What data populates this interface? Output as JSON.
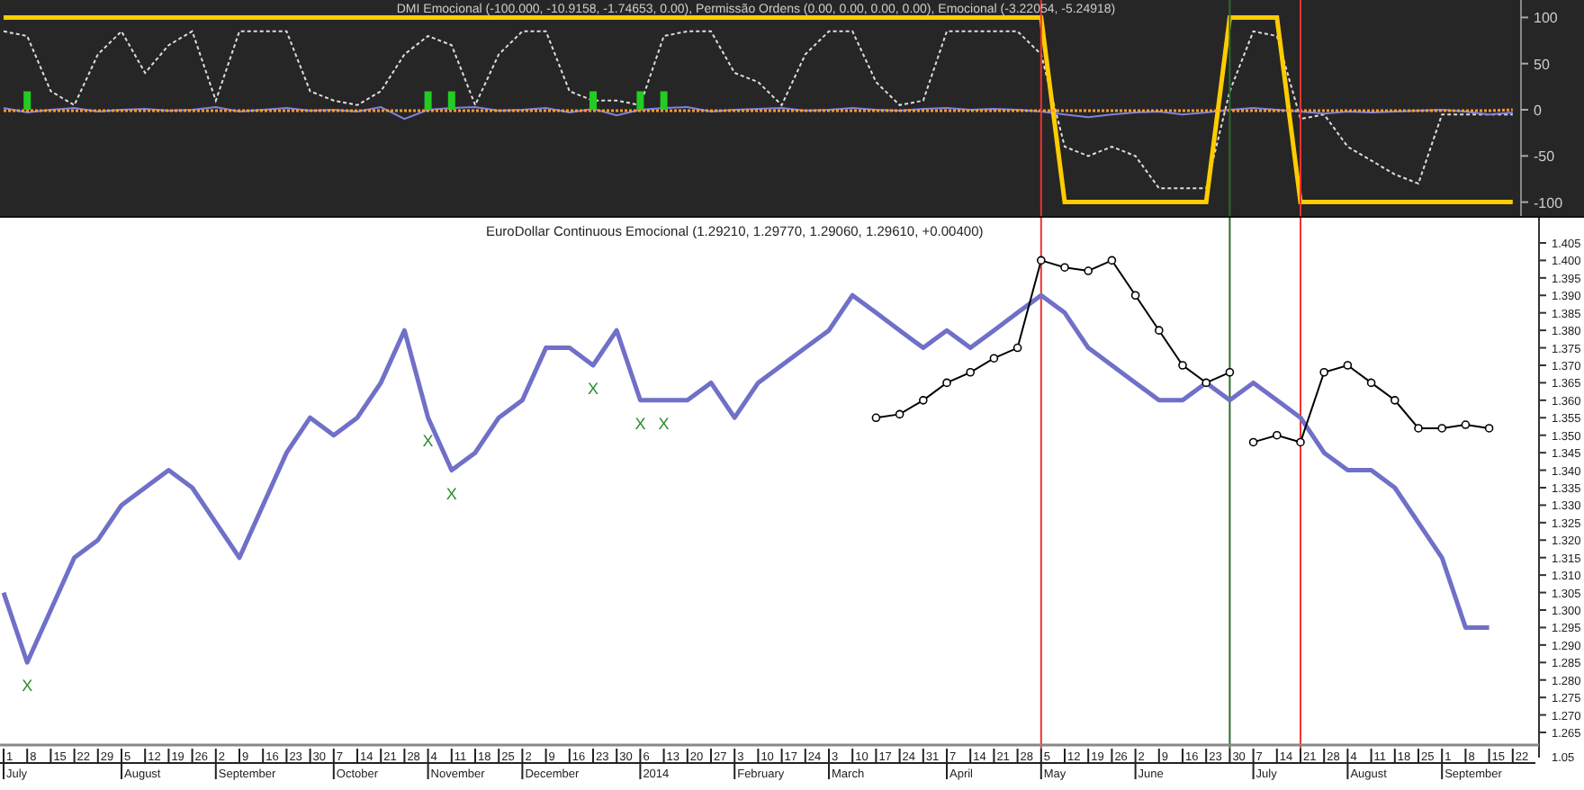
{
  "indicator_panel": {
    "chart_data": {
      "type": "line",
      "title": "DMI Emocional (-100.000, -10.9158, -1.74653, 0.00), Permissão Ordens (0.00, 0.00, 0.00, 0.00), Emocional (-3.22054, -5.24918)",
      "ylim": [
        -115,
        115
      ],
      "yticks": [
        100,
        50,
        0,
        -50,
        -100
      ],
      "series": [
        {
          "color": "#dddddd",
          "line_style": "dashed",
          "values": [
            85,
            80,
            20,
            5,
            60,
            85,
            40,
            70,
            85,
            10,
            85,
            85,
            85,
            20,
            10,
            5,
            20,
            60,
            80,
            70,
            5,
            60,
            85,
            85,
            20,
            10,
            10,
            5,
            80,
            85,
            85,
            40,
            30,
            5,
            60,
            85,
            85,
            30,
            5,
            10,
            85,
            85,
            85,
            85,
            60,
            -40,
            -50,
            -40,
            -50,
            -85,
            -85,
            -85,
            20,
            85,
            80,
            -10,
            -5,
            -40,
            -55,
            -70,
            -80,
            -5,
            -5,
            -5,
            -5
          ]
        },
        {
          "color": "#8080e0",
          "values": [
            2,
            -3,
            0,
            2,
            -2,
            0,
            1,
            -1,
            0,
            3,
            -2,
            0,
            2,
            -1,
            0,
            -2,
            3,
            -10,
            0,
            2,
            3,
            -1,
            0,
            2,
            -3,
            1,
            -6,
            0,
            2,
            3,
            -2,
            0,
            1,
            2,
            -1,
            0,
            2,
            0,
            -1,
            1,
            2,
            0,
            1,
            0,
            -2,
            -5,
            -8,
            -5,
            -3,
            -2,
            -5,
            -3,
            0,
            2,
            0,
            -2,
            -4,
            -2,
            -3,
            -2,
            -1,
            0,
            -2,
            -5,
            -3
          ]
        },
        {
          "color": "#ffcc00",
          "values": [
            100,
            100,
            100,
            100,
            100,
            100,
            100,
            100,
            100,
            100,
            100,
            100,
            100,
            100,
            100,
            100,
            100,
            100,
            100,
            100,
            100,
            100,
            100,
            100,
            100,
            100,
            100,
            100,
            100,
            100,
            100,
            100,
            100,
            100,
            100,
            100,
            100,
            100,
            100,
            100,
            100,
            100,
            100,
            100,
            100,
            -100,
            -100,
            -100,
            -100,
            -100,
            -100,
            -100,
            100,
            100,
            100,
            -100,
            -100,
            -100,
            -100,
            -100,
            -100,
            -100,
            -100,
            -100,
            -100
          ]
        },
        {
          "color": "#ff9933",
          "line_style": "dotted",
          "values": [
            -1,
            -1,
            -1,
            -1,
            -1,
            -1,
            -1,
            -1,
            -1,
            -1,
            -1,
            -1,
            -1,
            -1,
            -1,
            -1,
            -1,
            -1,
            -1,
            -1,
            -1,
            -1,
            -1,
            -1,
            -1,
            -1,
            -1,
            -1,
            -1,
            -1,
            -1,
            -1,
            -1,
            -1,
            -1,
            -1,
            -1,
            -1,
            -1,
            -1,
            -1,
            -1,
            -1,
            -1,
            -1,
            -1,
            -1,
            -1,
            -1,
            -1,
            -1,
            -1,
            -1,
            -1,
            -1,
            -1,
            -1,
            -1,
            -1,
            -1,
            -1,
            -1,
            -1,
            -1,
            0
          ]
        },
        {
          "type": "bar",
          "color": "#22cc22",
          "values": [
            null,
            20,
            null,
            null,
            null,
            null,
            null,
            null,
            null,
            null,
            null,
            null,
            null,
            null,
            null,
            null,
            null,
            null,
            20,
            20,
            null,
            null,
            null,
            null,
            null,
            20,
            null,
            20,
            20,
            null,
            null,
            null,
            null,
            null,
            null,
            null,
            null,
            null,
            null,
            null,
            null,
            null,
            null,
            null,
            null,
            null,
            null,
            null,
            null,
            null,
            null,
            null,
            null,
            null,
            null,
            null,
            null,
            null,
            null,
            null,
            null,
            null,
            null,
            null,
            null
          ]
        }
      ]
    }
  },
  "price_panel": {
    "chart_data": {
      "type": "line",
      "title": "EuroDollar Continuous Emocional (1.29210, 1.29770, 1.29060, 1.29610, +0.00400)",
      "ylim": [
        1.2614,
        1.4122
      ],
      "yticks": [
        1.405,
        {
          "value": 1.4,
          "label": "1.400"
        },
        1.395,
        {
          "value": 1.39,
          "label": "1.390"
        },
        1.385,
        {
          "value": 1.38,
          "label": "1.380"
        },
        1.375,
        {
          "value": 1.37,
          "label": "1.370"
        },
        1.365,
        {
          "value": 1.36,
          "label": "1.360"
        },
        1.355,
        {
          "value": 1.35,
          "label": "1.350"
        },
        1.345,
        {
          "value": 1.34,
          "label": "1.340"
        },
        1.335,
        {
          "value": 1.33,
          "label": "1.330"
        },
        1.325,
        {
          "value": 1.32,
          "label": "1.320"
        },
        1.315,
        {
          "value": 1.31,
          "label": "1.310"
        },
        1.305,
        {
          "value": 1.3,
          "label": "1.300"
        },
        1.295,
        {
          "value": 1.29,
          "label": "1.290"
        },
        1.285,
        {
          "value": 1.28,
          "label": "1.280"
        },
        1.275,
        {
          "value": 1.27,
          "label": "1.270"
        },
        1.265
      ],
      "series": [
        {
          "color": "#7070c8",
          "values": [
            1.305,
            1.285,
            1.3,
            1.315,
            1.32,
            1.33,
            1.335,
            1.34,
            1.335,
            1.325,
            1.315,
            1.33,
            1.345,
            1.355,
            1.35,
            1.355,
            1.365,
            1.38,
            1.355,
            1.34,
            1.345,
            1.355,
            1.36,
            1.375,
            1.375,
            1.37,
            1.38,
            1.36,
            1.36,
            1.36,
            1.365,
            1.355,
            1.365,
            1.37,
            1.375,
            1.38,
            1.39,
            1.385,
            1.38,
            1.375,
            1.38,
            1.375,
            1.38,
            1.385,
            1.39,
            1.385,
            1.375,
            1.37,
            1.365,
            1.36,
            1.36,
            1.365,
            1.36,
            1.365,
            1.36,
            1.355,
            1.345,
            1.34,
            1.34,
            1.335,
            1.325,
            1.315,
            1.295,
            1.295,
            null
          ]
        },
        {
          "color": "#000000",
          "marker": "circle",
          "values": [
            null,
            null,
            null,
            null,
            null,
            null,
            null,
            null,
            null,
            null,
            null,
            null,
            null,
            null,
            null,
            null,
            null,
            null,
            null,
            null,
            null,
            null,
            null,
            null,
            null,
            null,
            null,
            null,
            null,
            null,
            null,
            null,
            null,
            null,
            null,
            null,
            null,
            1.355,
            1.356,
            1.36,
            1.365,
            1.368,
            1.372,
            1.375,
            1.4,
            1.398,
            1.397,
            1.4,
            1.39,
            1.38,
            1.37,
            1.365,
            1.368,
            null,
            null,
            null,
            null,
            null,
            null,
            null,
            null,
            null,
            null,
            null,
            null
          ]
        },
        {
          "color": "#000000",
          "marker": "circle",
          "values": [
            null,
            null,
            null,
            null,
            null,
            null,
            null,
            null,
            null,
            null,
            null,
            null,
            null,
            null,
            null,
            null,
            null,
            null,
            null,
            null,
            null,
            null,
            null,
            null,
            null,
            null,
            null,
            null,
            null,
            null,
            null,
            null,
            null,
            null,
            null,
            null,
            null,
            null,
            null,
            null,
            null,
            null,
            null,
            null,
            null,
            null,
            null,
            null,
            null,
            null,
            null,
            null,
            null,
            1.348,
            1.35,
            1.348,
            1.368,
            1.37,
            1.365,
            1.36,
            1.352,
            1.352,
            1.353,
            1.352,
            null
          ]
        }
      ]
    },
    "axis_end_label": "1.05"
  },
  "date_axis": {
    "weeks": [
      {
        "day": "1",
        "month": "July"
      },
      {
        "day": "8",
        "signal": "X"
      },
      {
        "day": "15"
      },
      {
        "day": "22"
      },
      {
        "day": "29"
      },
      {
        "day": "5",
        "month": "August"
      },
      {
        "day": "12"
      },
      {
        "day": "19"
      },
      {
        "day": "26"
      },
      {
        "day": "2",
        "month": "September"
      },
      {
        "day": "9"
      },
      {
        "day": "16"
      },
      {
        "day": "23"
      },
      {
        "day": "30"
      },
      {
        "day": "7",
        "month": "October"
      },
      {
        "day": "14"
      },
      {
        "day": "21"
      },
      {
        "day": "28"
      },
      {
        "day": "4",
        "month": "November",
        "signal": "X"
      },
      {
        "day": "11",
        "signal": "X"
      },
      {
        "day": "18"
      },
      {
        "day": "25"
      },
      {
        "day": "2",
        "month": "December"
      },
      {
        "day": "9"
      },
      {
        "day": "16"
      },
      {
        "day": "23",
        "signal": "X"
      },
      {
        "day": "30"
      },
      {
        "day": "6",
        "month": "2014",
        "signal": "X"
      },
      {
        "day": "13",
        "signal": "X"
      },
      {
        "day": "20"
      },
      {
        "day": "27"
      },
      {
        "day": "3",
        "month": "February"
      },
      {
        "day": "10"
      },
      {
        "day": "17"
      },
      {
        "day": "24"
      },
      {
        "day": "3",
        "month": "March"
      },
      {
        "day": "10"
      },
      {
        "day": "17"
      },
      {
        "day": "24"
      },
      {
        "day": "31"
      },
      {
        "day": "7",
        "month": "April"
      },
      {
        "day": "14"
      },
      {
        "day": "21"
      },
      {
        "day": "28"
      },
      {
        "day": "5",
        "month": "May",
        "marker": true
      },
      {
        "day": "12"
      },
      {
        "day": "19"
      },
      {
        "day": "26"
      },
      {
        "day": "2",
        "month": "June"
      },
      {
        "day": "9"
      },
      {
        "day": "16"
      },
      {
        "day": "23"
      },
      {
        "day": "30",
        "alt_marker": true
      },
      {
        "day": "7",
        "month": "July"
      },
      {
        "day": "14"
      },
      {
        "day": "21",
        "marker": true
      },
      {
        "day": "28"
      },
      {
        "day": "4",
        "month": "August"
      },
      {
        "day": "11"
      },
      {
        "day": "18"
      },
      {
        "day": "25"
      },
      {
        "day": "1",
        "month": "September"
      },
      {
        "day": "8"
      },
      {
        "day": "15"
      },
      {
        "day": "22"
      }
    ]
  }
}
